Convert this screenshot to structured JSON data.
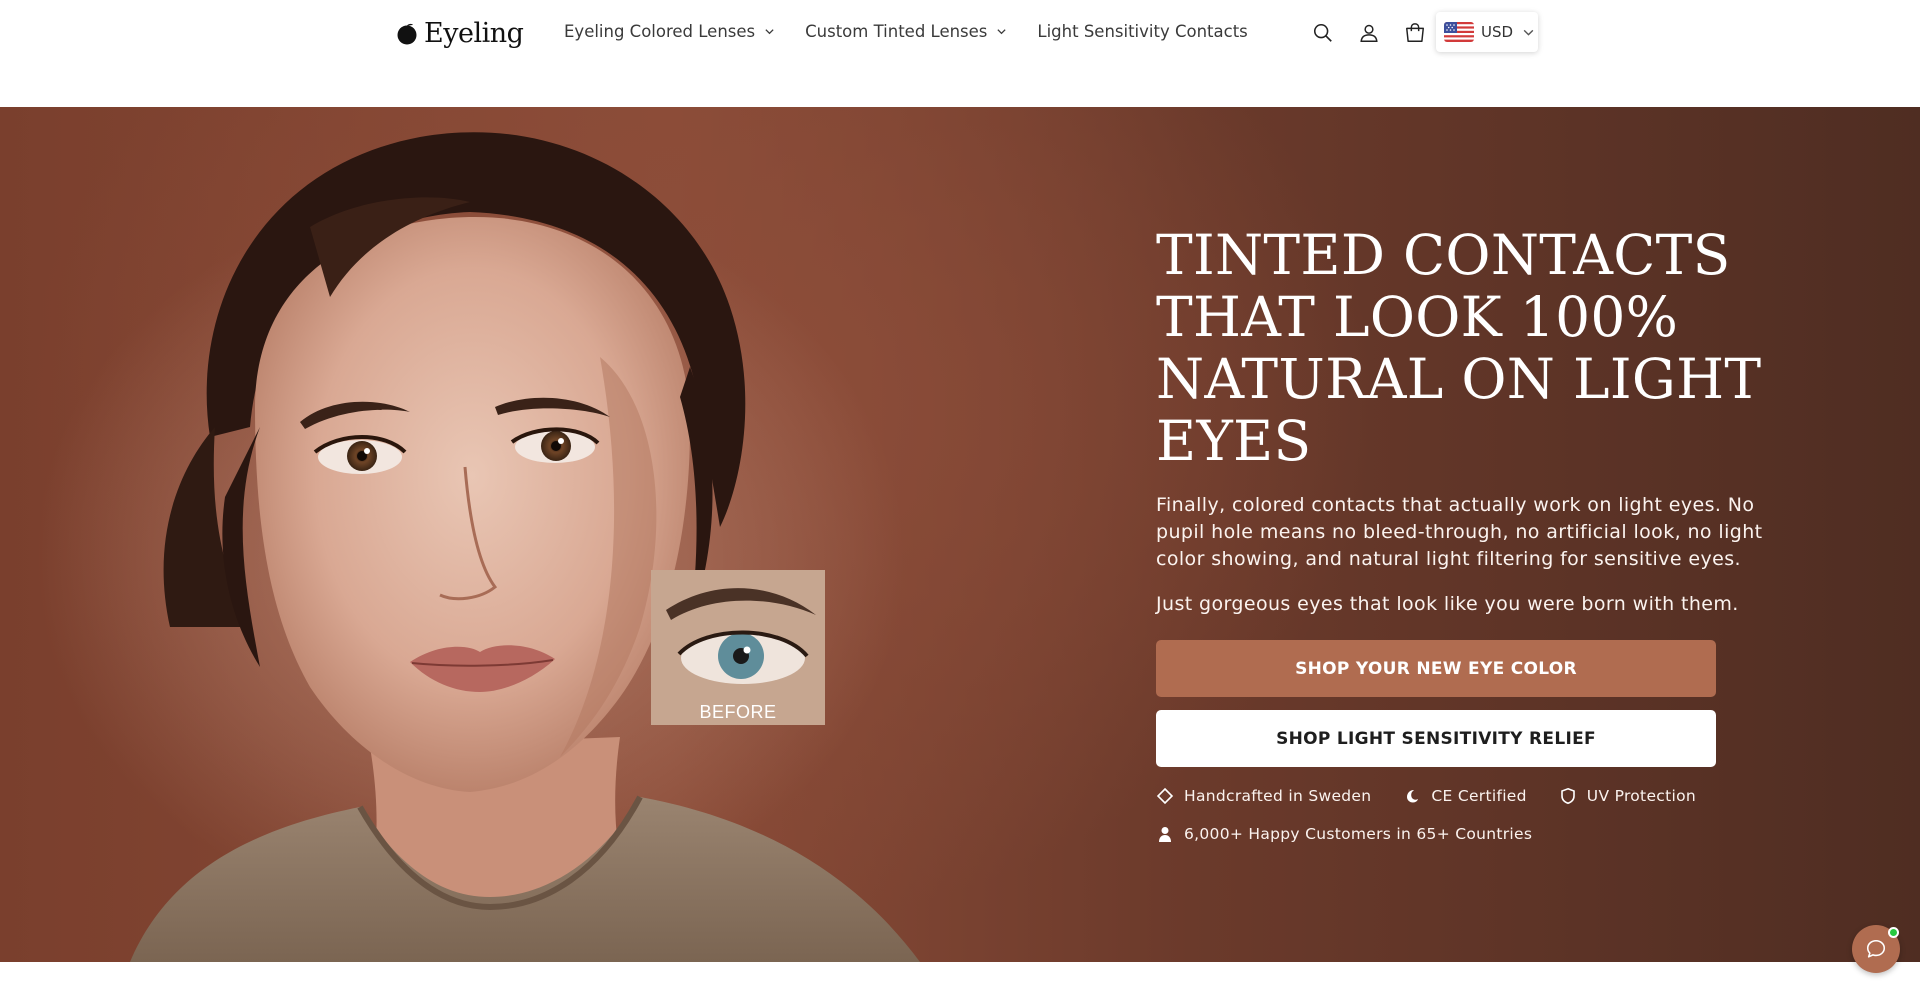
{
  "header": {
    "logo_text": "Eyeling",
    "nav": [
      {
        "label": "Eyeling Colored Lenses",
        "has_dropdown": true
      },
      {
        "label": "Custom Tinted Lenses",
        "has_dropdown": true
      },
      {
        "label": "Light Sensitivity Contacts",
        "has_dropdown": false
      }
    ],
    "icons": [
      "search-icon",
      "account-icon",
      "cart-icon"
    ],
    "currency": {
      "label": "USD",
      "flag": "us-flag-icon"
    }
  },
  "hero": {
    "title": "TINTED CONTACTS THAT LOOK 100% NATURAL ON LIGHT EYES",
    "description": "Finally, colored contacts that actually work on light eyes. No pupil hole means no bleed-through, no artificial look, no light color showing, and natural light filtering for sensitive eyes.",
    "subtext": "Just gorgeous eyes that look like you were born with them.",
    "primary_button": "SHOP YOUR NEW EYE COLOR",
    "secondary_button": "SHOP LIGHT SENSITIVITY RELIEF",
    "inset_label": "BEFORE",
    "badges": [
      {
        "icon": "diamond-icon",
        "label": "Handcrafted in Sweden"
      },
      {
        "icon": "moon-icon",
        "label": "CE Certified"
      },
      {
        "icon": "shield-icon",
        "label": "UV Protection"
      },
      {
        "icon": "person-icon",
        "label": "6,000+ Happy Customers in 65+ Countries"
      }
    ]
  },
  "colors": {
    "accent": "#b06c50",
    "hero_background": "#7a3f2d",
    "text_on_hero": "#ffffff"
  },
  "chat": {
    "icon": "chat-bubble-icon",
    "online": true
  }
}
